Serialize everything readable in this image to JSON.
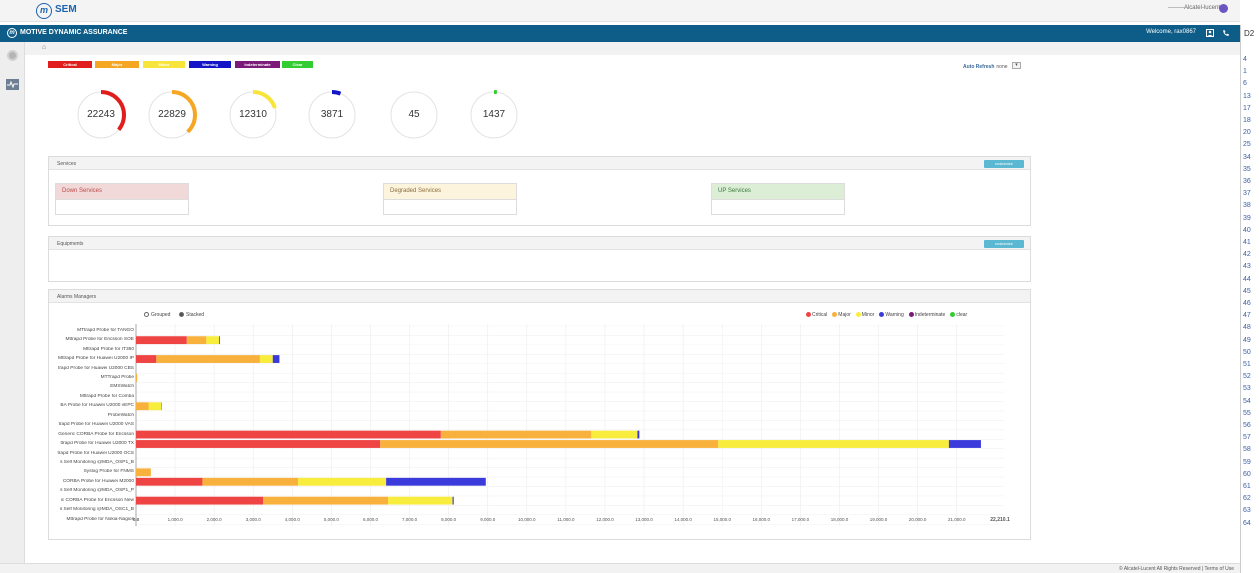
{
  "brand": {
    "logo_mark": "m",
    "name": "SEM",
    "user_text": "--------Alcatel-lucent"
  },
  "header": {
    "logo_mark": "m",
    "title": "MOTIVE DYNAMIC ASSURANCE",
    "welcome": "Welcome, rax0867",
    "right_code": "D2"
  },
  "breadcrumb": {
    "home_glyph": "⌂"
  },
  "severity_labels": [
    {
      "label": "Critical",
      "color": "#e01e1e"
    },
    {
      "label": "Major",
      "color": "#f5a623"
    },
    {
      "label": "Minor",
      "color": "#f7e53b"
    },
    {
      "label": "Warning",
      "color": "#1515c8"
    },
    {
      "label": "Indeterminate",
      "color": "#7b1a78"
    },
    {
      "label": "Clear",
      "color": "#33cc33"
    }
  ],
  "auto_refresh": {
    "label": "Auto Refresh",
    "value": "none",
    "dropdown_glyph": "▾"
  },
  "gauges": [
    {
      "value": "22243",
      "color": "#e01e1e",
      "fraction": 0.36
    },
    {
      "value": "22829",
      "color": "#f5a623",
      "fraction": 0.38
    },
    {
      "value": "12310",
      "color": "#f7e53b",
      "fraction": 0.2
    },
    {
      "value": "3871",
      "color": "#1515c8",
      "fraction": 0.06
    },
    {
      "value": "45",
      "color": "#7b1a78",
      "fraction": 0.0
    },
    {
      "value": "1437",
      "color": "#33cc33",
      "fraction": 0.02
    }
  ],
  "services_panel": {
    "title": "Services",
    "customize": "customize",
    "boxes": [
      "Down Services",
      "Degraded Services",
      "UP Services"
    ]
  },
  "equipments_panel": {
    "title": "Equipments",
    "customize": "customize"
  },
  "alarms_panel": {
    "title": "Alarms Managers",
    "grouped_label": "Grouped",
    "stacked_label": "Stacked",
    "legend": [
      "Critical",
      "Major",
      "Minor",
      "Warning",
      "Indeterminate",
      "clear"
    ]
  },
  "chart_data": {
    "type": "bar",
    "orientation": "horizontal",
    "stacked": true,
    "categories": [
      "MTtrapd Probe for TANGO",
      "Mttrapd Probe for Ericsson SOE",
      "Mttrapd Probe for IT360",
      "Mttrapd Probe for Huawei U2000 IP",
      "trapd Probe for Huawei U2000 CBS",
      "MTTrapd Probe",
      "EMSWatch",
      "Mttrapd Probe for Comba",
      "BA Probe for Huawei U2000 vEPC",
      "ProbeWatch",
      "trapd Probe for Huawei U2000 VAS",
      "Generic CORBA Probe for Ericsson",
      "ttrapd Probe for Huawei U2000 TX",
      "trapd Probe for Huawei U2000 OCS",
      "s Self Monitoring @MDA_OSP1_B",
      "Syslog Probe for FNMS",
      "CORBA Probe for Huawei M2000",
      "s Self Monitoring @MDA_OSP1_P",
      "ic CORBA Probe for Ericsson New",
      "s Self Monitoring @MDA_OSC1_B",
      "Mttrapd Probe for Nokia-Nagios"
    ],
    "series": [
      {
        "name": "Critical",
        "color": "#ef4444",
        "values": [
          0,
          1300,
          0,
          520,
          0,
          0,
          0,
          0,
          0,
          0,
          0,
          7800,
          6250,
          0,
          0,
          0,
          1700,
          0,
          3250,
          0,
          0
        ]
      },
      {
        "name": "Major",
        "color": "#f7b13c",
        "values": [
          0,
          500,
          0,
          2650,
          0,
          30,
          0,
          0,
          320,
          0,
          0,
          3850,
          8650,
          0,
          0,
          380,
          2450,
          0,
          3200,
          0,
          0
        ]
      },
      {
        "name": "Minor",
        "color": "#f8ec3c",
        "values": [
          0,
          330,
          0,
          330,
          0,
          0,
          0,
          0,
          330,
          0,
          0,
          1180,
          5900,
          0,
          0,
          0,
          2250,
          0,
          1650,
          0,
          0
        ]
      },
      {
        "name": "Warning",
        "color": "#3b3bdb",
        "values": [
          0,
          20,
          0,
          170,
          0,
          0,
          0,
          0,
          10,
          0,
          0,
          50,
          820,
          0,
          0,
          0,
          2550,
          0,
          30,
          0,
          0
        ]
      },
      {
        "name": "Indeterminate",
        "color": "#7b1a78",
        "values": [
          0,
          0,
          0,
          0,
          0,
          0,
          0,
          0,
          0,
          0,
          0,
          0,
          0,
          0,
          0,
          0,
          0,
          0,
          0,
          0,
          0
        ]
      },
      {
        "name": "clear",
        "color": "#33cc33",
        "values": [
          0,
          0,
          0,
          0,
          0,
          0,
          0,
          0,
          0,
          0,
          0,
          0,
          0,
          0,
          0,
          0,
          0,
          0,
          0,
          0,
          0
        ]
      }
    ],
    "x_ticks": [
      "0.0",
      "1,000.0",
      "2,000.0",
      "3,000.0",
      "4,000.0",
      "5,000.0",
      "6,000.0",
      "7,000.0",
      "8,000.0",
      "9,000.0",
      "10,000.0",
      "11,000.0",
      "12,000.0",
      "13,000.0",
      "14,000.0",
      "15,000.0",
      "16,000.0",
      "17,000.0",
      "18,000.0",
      "19,000.0",
      "20,000.0",
      "21,000.0"
    ],
    "x_max_label": "22,210.1",
    "xlim": [
      0,
      22210.1
    ],
    "grid": true,
    "legend_position": "top-right"
  },
  "right_numbers": [
    "4",
    "1",
    "6",
    "13",
    "17",
    "18",
    "20",
    "25",
    "34",
    "35",
    "36",
    "37",
    "38",
    "39",
    "40",
    "41",
    "42",
    "43",
    "44",
    "45",
    "46",
    "47",
    "48",
    "49",
    "50",
    "51",
    "52",
    "53",
    "54",
    "55",
    "56",
    "57",
    "58",
    "59",
    "60",
    "61",
    "62",
    "63",
    "64"
  ],
  "footer": {
    "text": "© Alcatel-Lucent All Rights Reserved | Terms of Use"
  }
}
